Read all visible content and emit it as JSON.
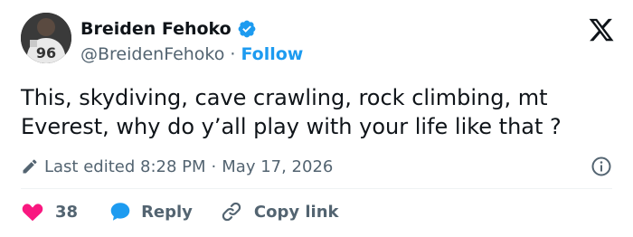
{
  "author": {
    "display_name": "Breiden Fehoko",
    "handle": "@BreidenFehoko",
    "separator": "·",
    "follow_label": "Follow",
    "avatar_jersey_number": "96",
    "verified_color": "#1d9bf0"
  },
  "tweet": {
    "text": "This, skydiving, cave crawling, rock climbing, mt Everest, why do y’all play with your life like that ?"
  },
  "meta": {
    "edited_label": "Last edited 8:28 PM",
    "separator": "·",
    "date": "May 17, 2026"
  },
  "actions": {
    "like_count": "38",
    "reply_label": "Reply",
    "copy_link_label": "Copy link"
  },
  "colors": {
    "accent": "#1d9bf0",
    "like": "#f91880",
    "secondary_text": "#536471"
  },
  "icons": {
    "brand": "x-logo-icon",
    "verified": "verified-badge-icon",
    "edit": "pencil-icon",
    "info": "info-icon",
    "like": "heart-icon",
    "reply": "speech-bubble-icon",
    "copy": "link-icon"
  }
}
